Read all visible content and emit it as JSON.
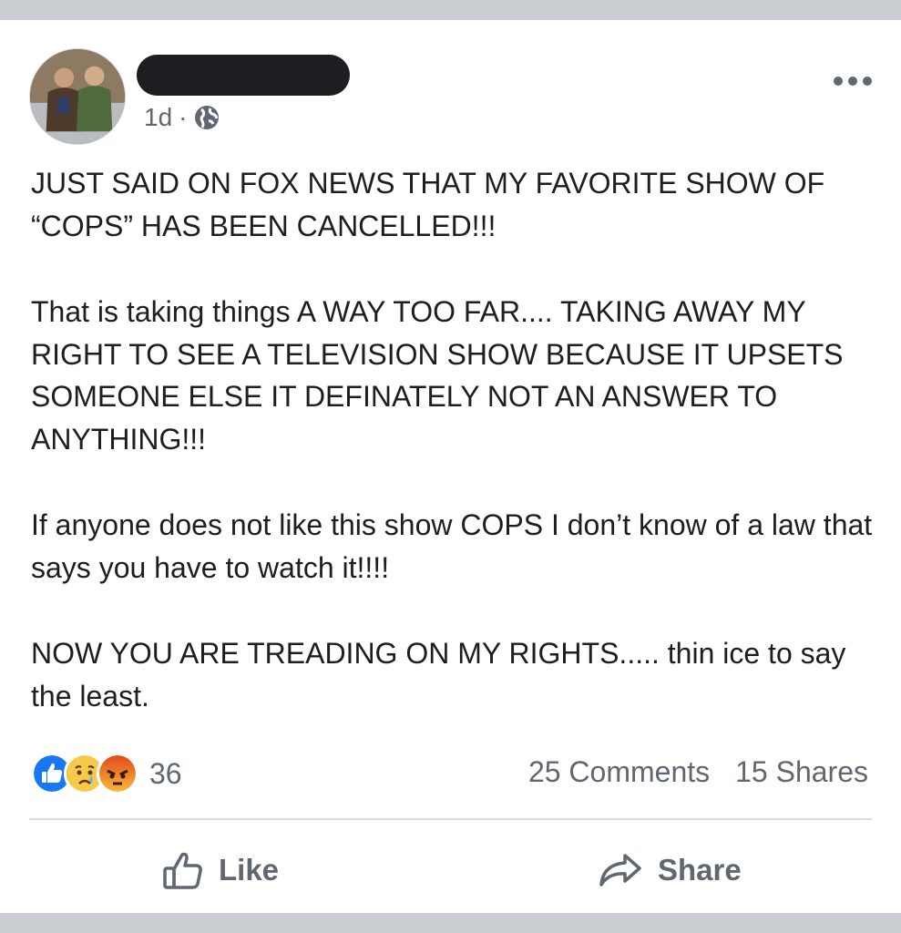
{
  "post": {
    "timestamp": "1d",
    "separator": "·",
    "paragraphs": [
      "JUST SAID ON FOX NEWS THAT MY FAVORITE SHOW OF “COPS” HAS BEEN CANCELLED!!!",
      "That is taking things A WAY TOO FAR.... TAKING AWAY MY RIGHT TO SEE A TELEVISION SHOW BECAUSE IT UPSETS SOMEONE ELSE IT DEFINATELY NOT AN ANSWER TO ANYTHING!!!",
      "If anyone does not like this show COPS I don’t know of a law that says you have to watch it!!!!",
      "NOW YOU ARE TREADING ON MY RIGHTS..... thin ice to say the least."
    ]
  },
  "engagement": {
    "reaction_icons": [
      "like-icon",
      "sad-icon",
      "angry-icon"
    ],
    "reaction_count": "36",
    "comments": "25 Comments",
    "shares": "15 Shares"
  },
  "actions": {
    "like_label": "Like",
    "share_label": "Share"
  },
  "colors": {
    "like_blue": "#1877f2",
    "emoji_yellow": "#f7c949",
    "angry_orange": "#e9710f",
    "muted_text": "#606770"
  }
}
